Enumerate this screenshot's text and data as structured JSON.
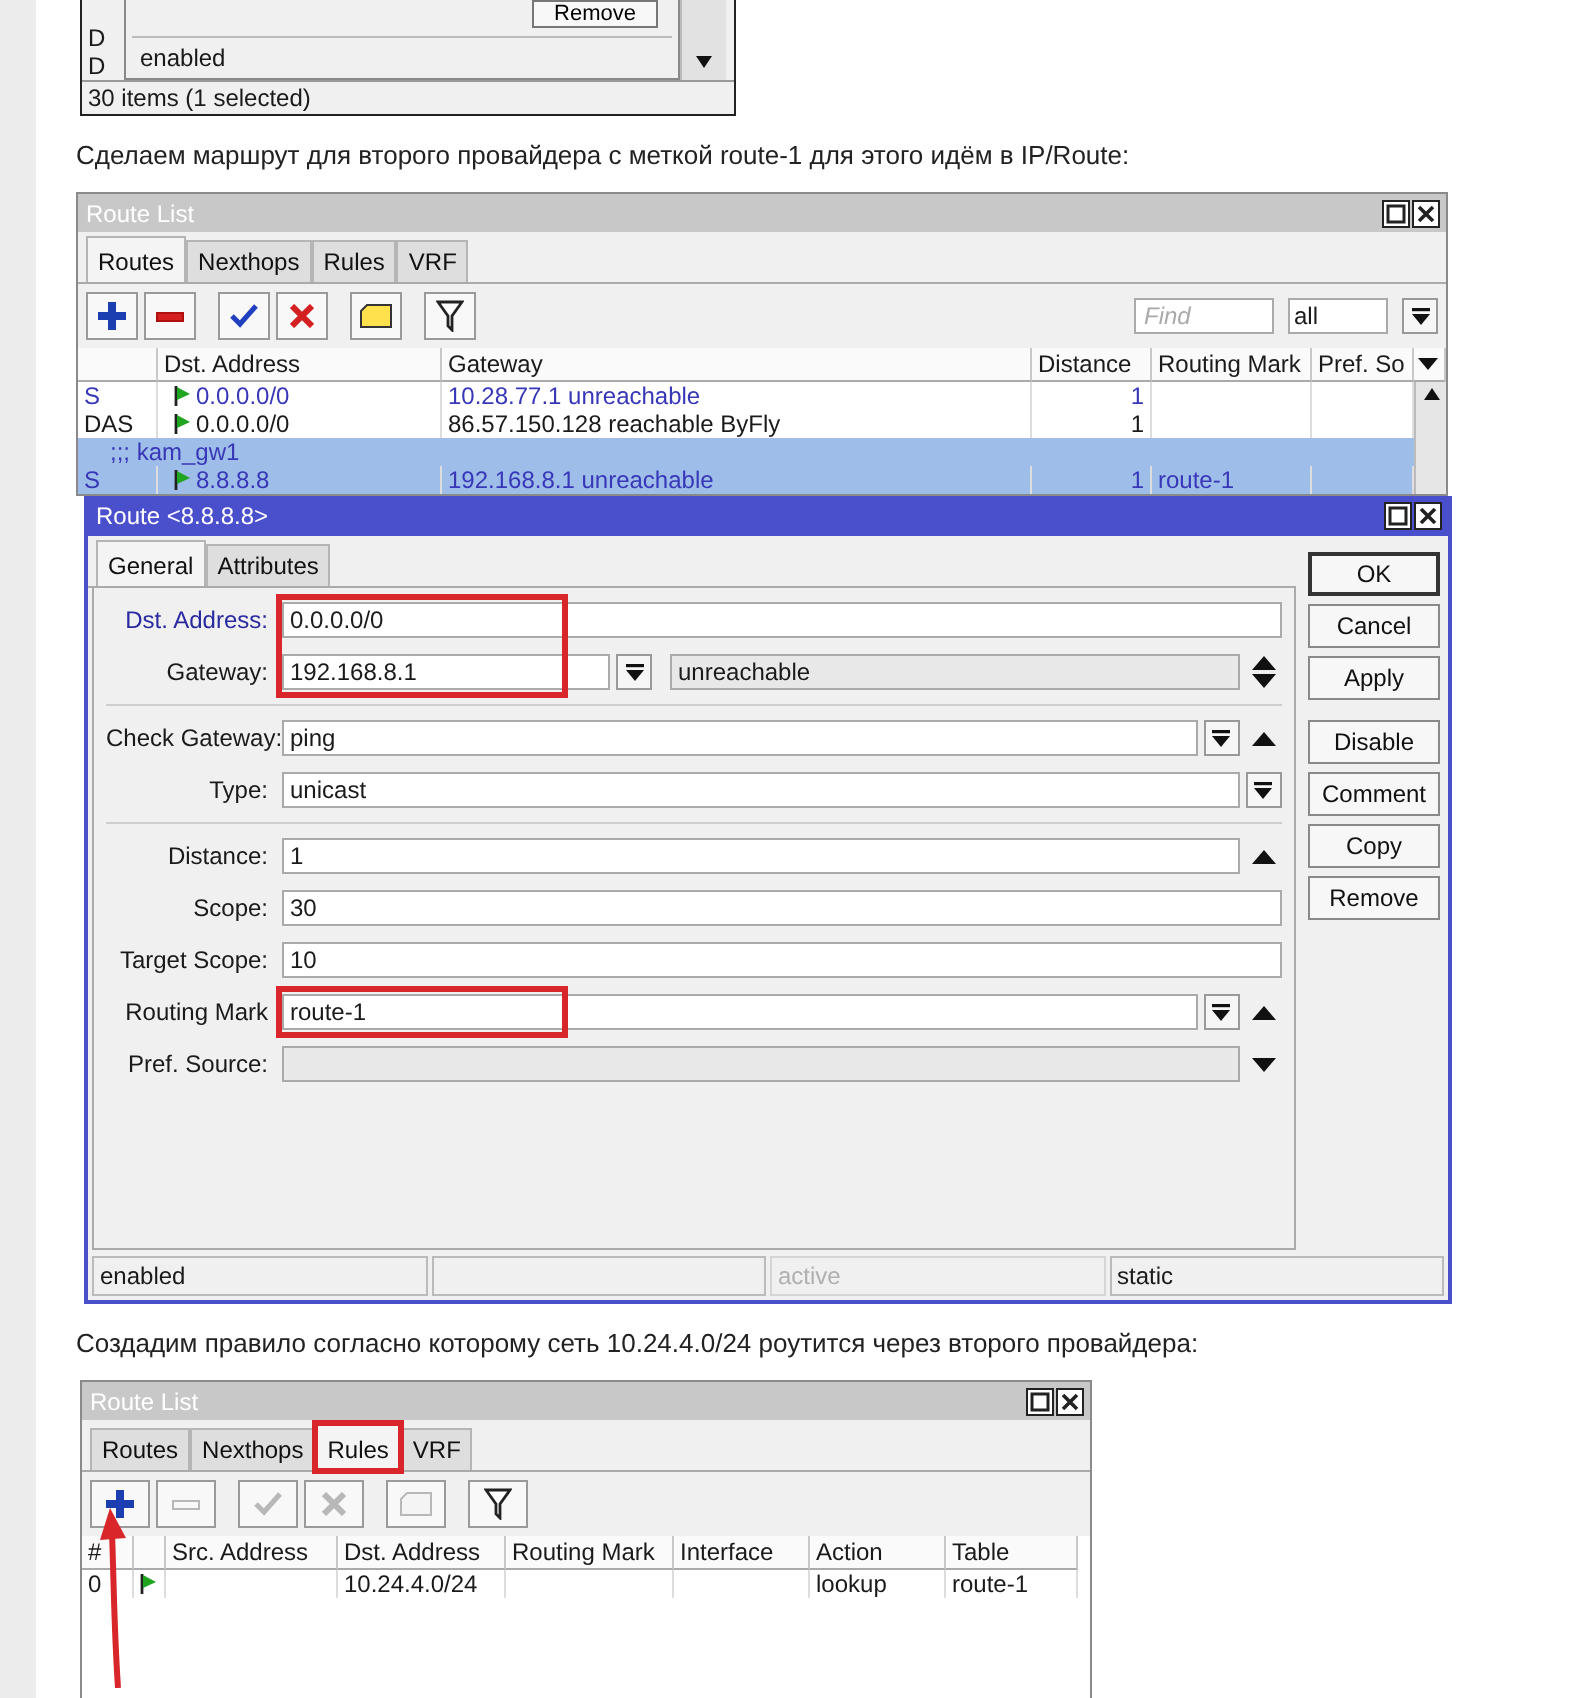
{
  "top_fragment": {
    "row_flags": [
      "D",
      "D"
    ],
    "dialog": {
      "button": "Remove",
      "status": "enabled"
    },
    "footer": "30 items (1 selected)"
  },
  "text_1": "Сделаем маршрут для второго провайдера с меткой route-1 для этого идём в IP/Route:",
  "route_list": {
    "title": "Route List",
    "tabs": [
      {
        "label": "Routes",
        "selected": true
      },
      {
        "label": "Nexthops",
        "selected": false
      },
      {
        "label": "Rules",
        "selected": false
      },
      {
        "label": "VRF",
        "selected": false
      }
    ],
    "toolbar": [
      {
        "kind": "add",
        "disabled": false
      },
      {
        "kind": "remove",
        "disabled": false
      },
      {
        "kind": "enable",
        "disabled": false
      },
      {
        "kind": "disable",
        "disabled": false
      },
      {
        "kind": "comment",
        "disabled": false
      },
      {
        "kind": "filter",
        "disabled": false
      }
    ],
    "find": {
      "placeholder": "Find"
    },
    "filter_value": "all",
    "columns": [
      "Dst. Address",
      "Gateway",
      "Distance",
      "Routing Mark",
      "Pref. So"
    ],
    "rows": [
      {
        "kind": "route",
        "flags": "S",
        "dst": "0.0.0.0/0",
        "gateway": "10.28.77.1 unreachable",
        "distance": "1",
        "unreachable": true,
        "selected": false
      },
      {
        "kind": "route",
        "flags": "DAS",
        "dst": "0.0.0.0/0",
        "gateway": "86.57.150.128 reachable ByFly",
        "distance": "1",
        "unreachable": false,
        "selected": false
      },
      {
        "kind": "comment",
        "text": ";;; kam_gw1",
        "selected": true
      },
      {
        "kind": "route",
        "flags": "S",
        "dst": "8.8.8.8",
        "gateway": "192.168.8.1 unreachable",
        "distance": "1",
        "mark": "route-1",
        "unreachable": true,
        "selected": true
      }
    ]
  },
  "route_dialog": {
    "title": "Route <8.8.8.8>",
    "tabs": [
      {
        "label": "General",
        "selected": true
      },
      {
        "label": "Attributes",
        "selected": false
      }
    ],
    "sections": [
      [
        {
          "label": "Dst. Address:",
          "value": "0.0.0.0/0",
          "kind": "text",
          "focused": true,
          "annotated": true
        },
        {
          "label": "Gateway:",
          "value": "192.168.8.1",
          "kind": "gateway",
          "status": "unreachable",
          "focused": false,
          "annotated": true
        }
      ],
      [
        {
          "label": "Check Gateway:",
          "value": "ping",
          "kind": "select_up",
          "focused": false,
          "annotated": false
        },
        {
          "label": "Type:",
          "value": "unicast",
          "kind": "select",
          "focused": false,
          "annotated": false
        }
      ],
      [
        {
          "label": "Distance:",
          "value": "1",
          "kind": "text_up",
          "focused": false,
          "annotated": false
        },
        {
          "label": "Scope:",
          "value": "30",
          "kind": "text",
          "focused": false,
          "annotated": false
        },
        {
          "label": "Target Scope:",
          "value": "10",
          "kind": "text",
          "focused": false,
          "annotated": false
        },
        {
          "label": "Routing Mark",
          "value": "route-1",
          "kind": "select_up",
          "focused": false,
          "annotated": true
        },
        {
          "label": "Pref. Source:",
          "kind": "empty_down",
          "focused": false,
          "annotated": false
        }
      ]
    ],
    "button_groups": [
      [
        {
          "label": "OK",
          "default": true
        },
        {
          "label": "Cancel",
          "default": false
        },
        {
          "label": "Apply",
          "default": false
        }
      ],
      [
        {
          "label": "Disable",
          "default": false
        },
        {
          "label": "Comment",
          "default": false
        },
        {
          "label": "Copy",
          "default": false
        },
        {
          "label": "Remove",
          "default": false
        }
      ]
    ],
    "status_bar": [
      {
        "text": "enabled",
        "greyed": false
      },
      {
        "greyed": false
      },
      {
        "text": "active",
        "greyed": true
      },
      {
        "text": "static",
        "greyed": false
      }
    ]
  },
  "text_2": "Создадим правило согласно которому сеть 10.24.4.0/24 роутится через второго провайдера:",
  "rules_window": {
    "title": "Route List",
    "tabs": [
      {
        "label": "Routes",
        "selected": false,
        "annotated": false
      },
      {
        "label": "Nexthops",
        "selected": false,
        "annotated": false
      },
      {
        "label": "Rules",
        "selected": true,
        "annotated": true
      },
      {
        "label": "VRF",
        "selected": false,
        "annotated": false
      }
    ],
    "toolbar": [
      {
        "kind": "add",
        "disabled": false
      },
      {
        "kind": "remove",
        "disabled": true
      },
      {
        "kind": "enable",
        "disabled": true
      },
      {
        "kind": "disable",
        "disabled": true
      },
      {
        "kind": "comment",
        "disabled": true
      },
      {
        "kind": "filter",
        "disabled": false
      }
    ],
    "columns": [
      "#",
      "Src. Address",
      "Dst. Address",
      "Routing Mark",
      "Interface",
      "Action",
      "Table"
    ],
    "rows": [
      {
        "number": "0",
        "dst": "10.24.4.0/24",
        "action": "lookup",
        "table": "route-1",
        "selected": false
      }
    ]
  }
}
